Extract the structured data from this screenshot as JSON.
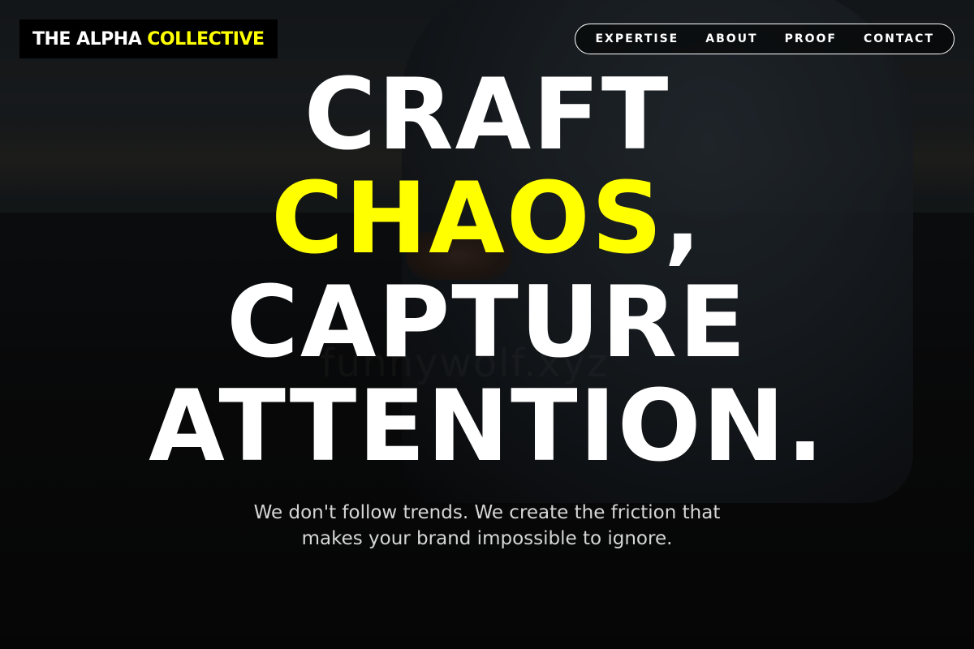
{
  "brand": {
    "name_part1": "THE ALPHA",
    "name_part2": "COLLECTIVE",
    "accent_color": "#ffff00"
  },
  "nav": {
    "items": [
      {
        "label": "EXPERTISE"
      },
      {
        "label": "ABOUT"
      },
      {
        "label": "PROOF"
      },
      {
        "label": "CONTACT"
      }
    ]
  },
  "hero": {
    "line1": "CRAFT",
    "line2_accent": "CHAOS",
    "line2_rest": ",",
    "line3": "CAPTURE",
    "line4": "ATTENTION.",
    "subtext_line1": "We don't follow trends. We create the friction that",
    "subtext_line2": "makes your brand impossible to ignore.",
    "watermark": "funnywolf.xyz"
  }
}
